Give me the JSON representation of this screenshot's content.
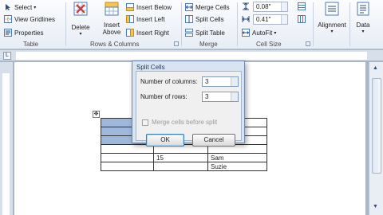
{
  "ribbon": {
    "table_group": {
      "select_label": "Select",
      "gridlines_label": "View Gridlines",
      "properties_label": "Properties",
      "group_label": "Table"
    },
    "rows_columns_group": {
      "delete_label": "Delete",
      "insert_above_label": "Insert Above",
      "insert_below_label": "Insert Below",
      "insert_left_label": "Insert Left",
      "insert_right_label": "Insert Right",
      "group_label": "Rows & Columns"
    },
    "merge_group": {
      "merge_cells_label": "Merge Cells",
      "split_cells_label": "Split Cells",
      "split_table_label": "Split Table",
      "group_label": "Merge"
    },
    "cell_size_group": {
      "height_value": "0.08\"",
      "width_value": "0.41\"",
      "autofit_label": "AutoFit",
      "group_label": "Cell Size"
    },
    "alignment_label": "Alignment",
    "data_label": "Data"
  },
  "dialog": {
    "title": "Split Cells",
    "columns_label": "Number of columns:",
    "columns_value": "3",
    "rows_label": "Number of rows:",
    "rows_value": "3",
    "merge_label": "Merge cells before split",
    "ok_label": "OK",
    "cancel_label": "Cancel"
  },
  "document": {
    "rows": [
      [
        "",
        "",
        ""
      ],
      [
        "",
        "",
        ""
      ],
      [
        "",
        "",
        ""
      ],
      [
        "",
        "",
        ""
      ],
      [
        "",
        "15",
        "Sam"
      ],
      [
        "",
        "",
        "Suzie"
      ]
    ]
  },
  "colors": {
    "accent": "#1e395b",
    "selection": "#9fb8dc"
  }
}
